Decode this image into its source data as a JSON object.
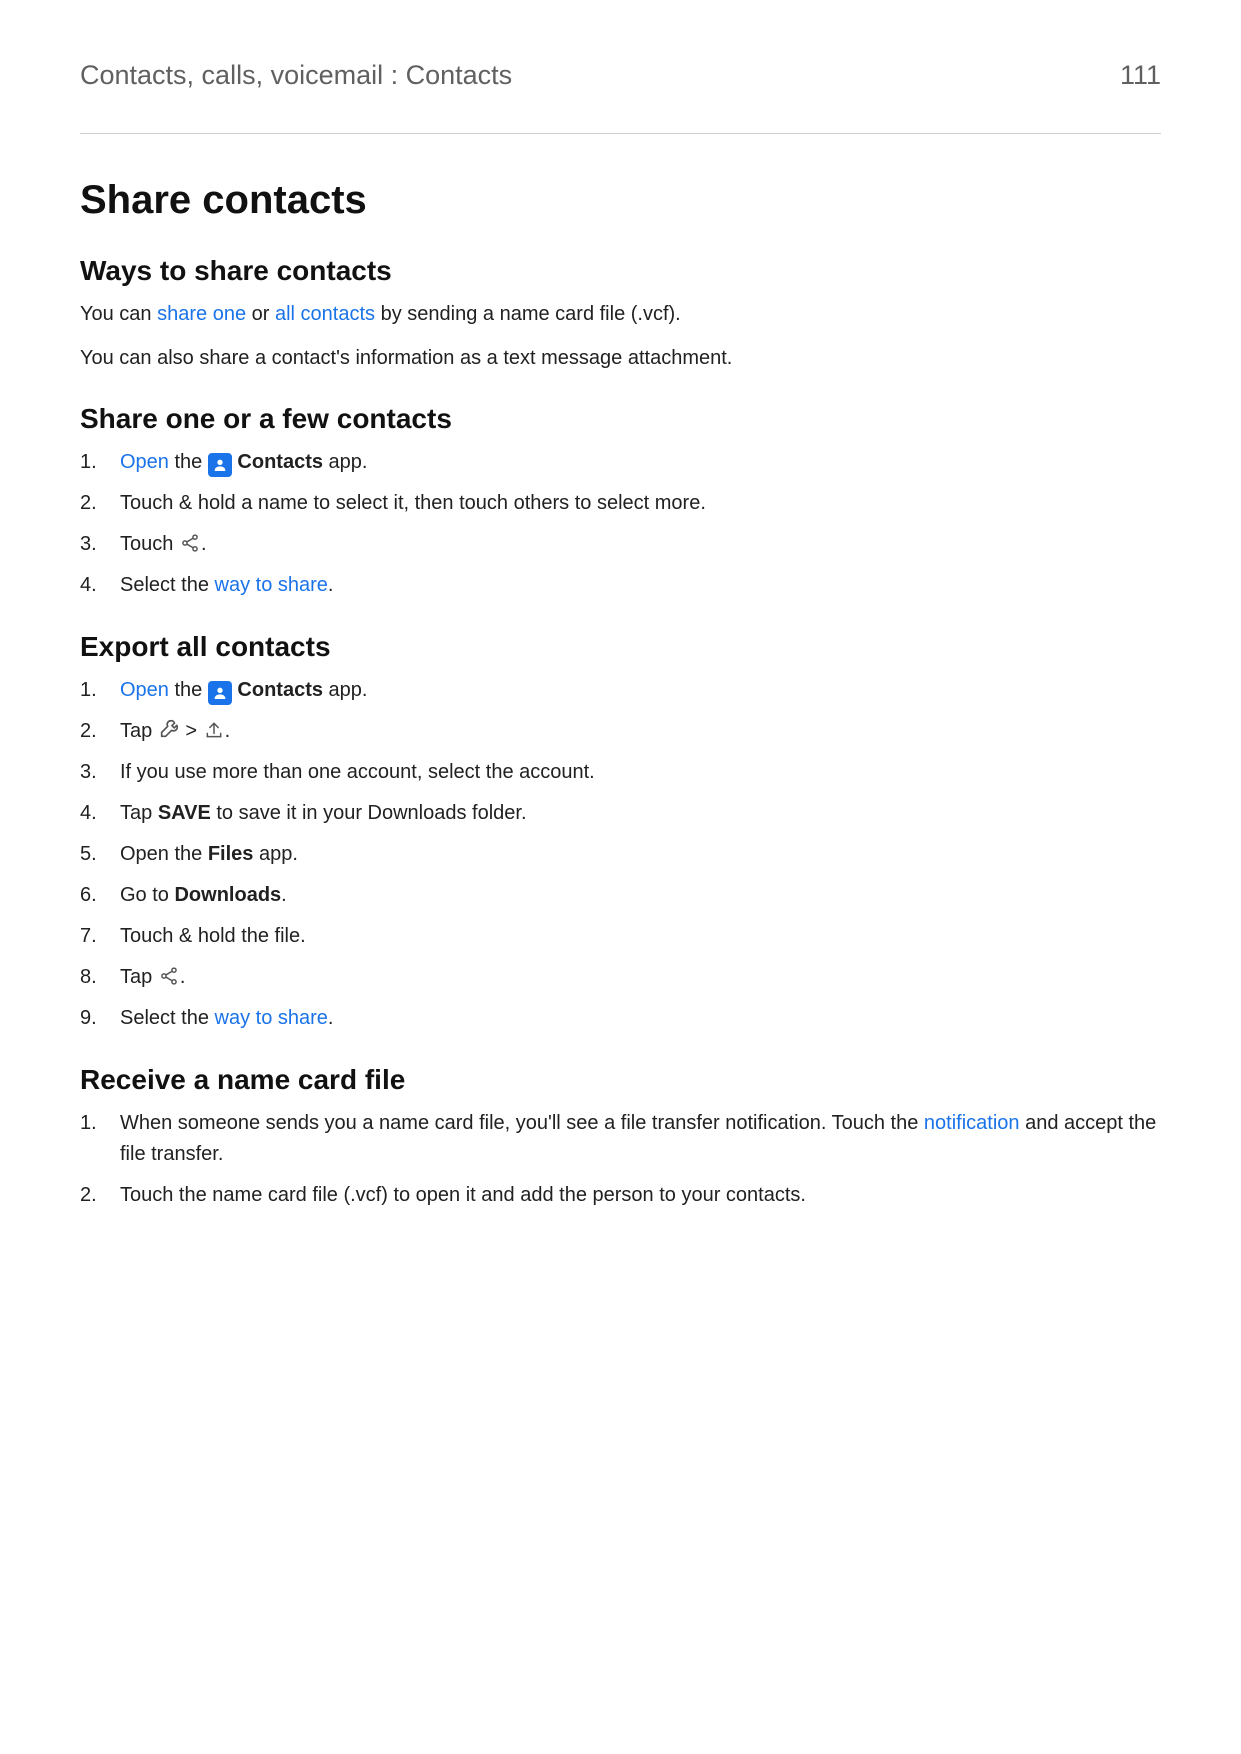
{
  "header": {
    "breadcrumb": "Contacts, calls, voicemail : Contacts",
    "page_number": "111"
  },
  "title": "Share contacts",
  "sections": {
    "ways": {
      "heading": "Ways to share contacts",
      "p1_a": "You can ",
      "p1_link1": "share one",
      "p1_b": " or ",
      "p1_link2": "all contacts",
      "p1_c": " by sending a name card file (.vcf).",
      "p2": "You can also share a contact's information as a text message attachment."
    },
    "share_one": {
      "heading": "Share one or a few contacts",
      "s1_link": "Open",
      "s1_a": " the ",
      "s1_bold": "Contacts",
      "s1_b": " app.",
      "s2": "Touch & hold a name to select it, then touch others to select more.",
      "s3_a": "Touch ",
      "s3_b": ".",
      "s4_a": "Select the ",
      "s4_link": "way to share",
      "s4_b": "."
    },
    "export": {
      "heading": "Export all contacts",
      "s1_link": "Open",
      "s1_a": " the ",
      "s1_bold": "Contacts",
      "s1_b": " app.",
      "s2_a": "Tap ",
      "s2_sep": " > ",
      "s2_b": ".",
      "s3": "If you use more than one account, select the account.",
      "s4_a": "Tap ",
      "s4_bold": "SAVE",
      "s4_b": " to save it in your Downloads folder.",
      "s5_a": "Open the ",
      "s5_bold": "Files",
      "s5_b": " app.",
      "s6_a": "Go to ",
      "s6_bold": "Downloads",
      "s6_b": ".",
      "s7": "Touch & hold the file.",
      "s8_a": "Tap ",
      "s8_b": ".",
      "s9_a": "Select the ",
      "s9_link": "way to share",
      "s9_b": "."
    },
    "receive": {
      "heading": "Receive a name card file",
      "s1_a": "When someone sends you a name card file, you'll see a file transfer notification. Touch the ",
      "s1_link": "notification",
      "s1_b": " and accept the file transfer.",
      "s2": "Touch the name card file (.vcf) to open it and add the person to your contacts."
    }
  }
}
